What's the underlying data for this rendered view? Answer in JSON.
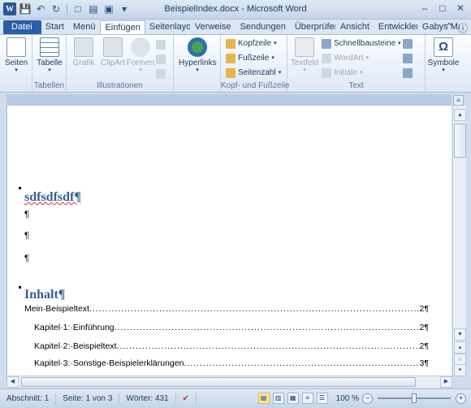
{
  "window": {
    "title": "BeispielIndex.docx - Microsoft Word",
    "quick_access": [
      "word-logo",
      "save-icon",
      "undo-icon",
      "redo-icon",
      "customize-icon"
    ]
  },
  "tabs": [
    {
      "label": "Datei"
    },
    {
      "label": "Start"
    },
    {
      "label": "Menü"
    },
    {
      "label": "Einfügen"
    },
    {
      "label": "Seitenlayout"
    },
    {
      "label": "Verweise"
    },
    {
      "label": "Sendungen"
    },
    {
      "label": "Überprüfen"
    },
    {
      "label": "Ansicht"
    },
    {
      "label": "Entwicklertools"
    },
    {
      "label": "Gabys Makro"
    }
  ],
  "ribbon": {
    "groups": {
      "seiten": {
        "button": "Seiten",
        "label": ""
      },
      "tabellen": {
        "button": "Tabelle",
        "label": "Tabellen"
      },
      "illustrationen": {
        "grafik": "Grafik",
        "clipart": "ClipArt",
        "formen": "Formen",
        "label": "Illustrationen"
      },
      "links": {
        "button": "Hyperlinks"
      },
      "kopf": {
        "kopfzeile": "Kopfzeile",
        "fusszeile": "Fußzeile",
        "seitenzahl": "Seitenzahl",
        "label": "Kopf- und Fußzeile"
      },
      "text": {
        "textfeld": "Textfeld",
        "schnellbausteine": "Schnellbausteine",
        "wordart": "WordArt",
        "initiale": "Initiale",
        "label": "Text"
      },
      "symbole": {
        "button": "Symbole"
      }
    }
  },
  "document": {
    "heading1": "sdfsdfsdf¶",
    "para_marks": [
      "¶",
      "¶",
      "¶"
    ],
    "heading2": "Inhalt¶",
    "toc": [
      {
        "text": "Mein·Beispieltext",
        "page": "2¶"
      },
      {
        "text": "Kapitel·1:·Einführung",
        "page": "2¶"
      },
      {
        "text": "Kapitel·2:·Beispieltext",
        "page": "2¶"
      },
      {
        "text": "Kapitel·3:·Sonstige·Beispielerklärungen",
        "page": "3¶"
      }
    ]
  },
  "status": {
    "section": "Abschnitt: 1",
    "page": "Seite: 1 von 3",
    "words": "Wörter: 431",
    "zoom": "100 %"
  },
  "colors": {
    "accent": "#2a5ea8",
    "heading": "#366091"
  }
}
